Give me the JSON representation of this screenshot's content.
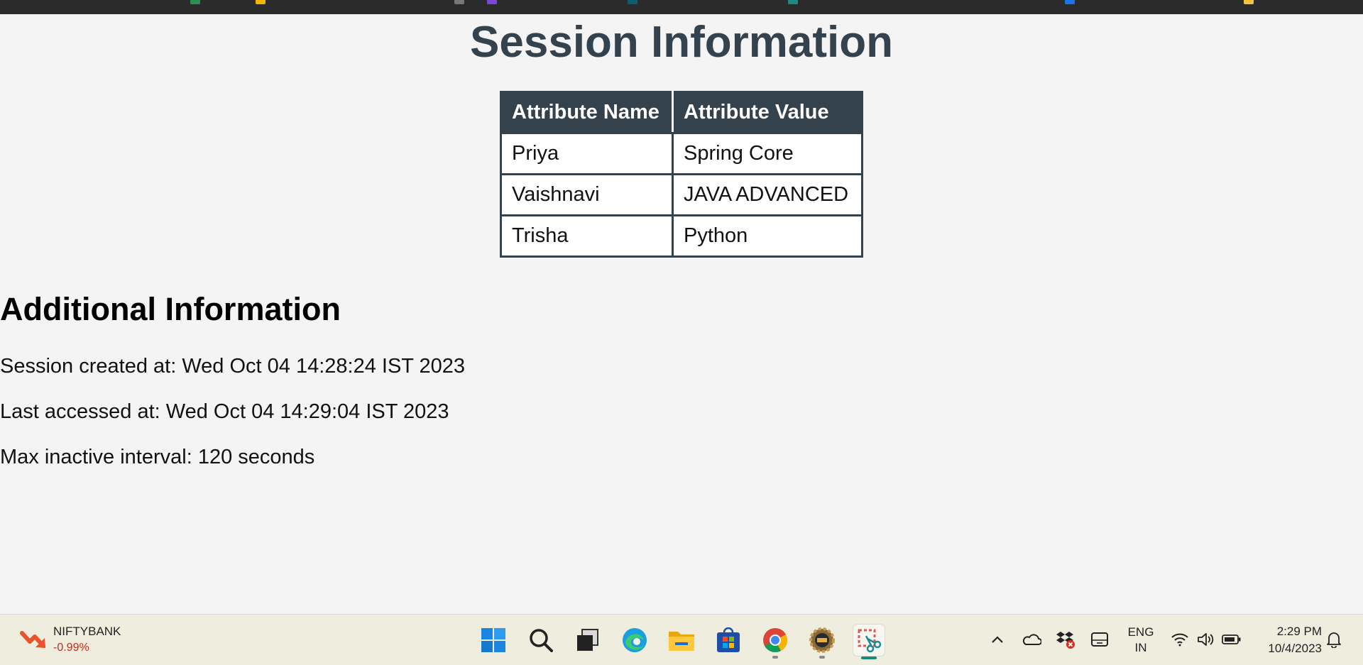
{
  "page": {
    "title": "Session Information",
    "table": {
      "headers": [
        "Attribute Name",
        "Attribute Value"
      ],
      "rows": [
        [
          "Priya",
          "Spring Core"
        ],
        [
          "Vaishnavi",
          "JAVA ADVANCED"
        ],
        [
          "Trisha",
          "Python"
        ]
      ]
    },
    "additional_heading": "Additional Information",
    "created": "Session created at: Wed Oct 04 14:28:24 IST 2023",
    "accessed": "Last accessed at: Wed Oct 04 14:29:04 IST 2023",
    "max_interval": "Max inactive interval: 120 seconds"
  },
  "taskbar": {
    "widget": {
      "name": "NIFTYBANK",
      "change": "-0.99%",
      "change_color": "#c42b1c"
    },
    "apps": [
      "start-icon",
      "search-icon",
      "task-view-icon",
      "edge-icon",
      "file-explorer-icon",
      "microsoft-store-icon",
      "chrome-icon",
      "java-ide-icon",
      "snipping-tool-icon"
    ],
    "tray": [
      "chevron-up-icon",
      "onedrive-icon",
      "dropbox-icon",
      "touch-keyboard-icon"
    ],
    "language": {
      "line1": "ENG",
      "line2": "IN"
    },
    "system": [
      "wifi-icon",
      "volume-icon",
      "battery-icon"
    ],
    "clock": {
      "time": "2:29 PM",
      "date": "10/4/2023"
    }
  }
}
